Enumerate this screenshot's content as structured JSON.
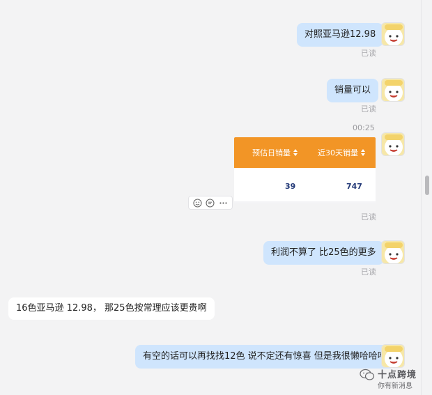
{
  "messages": [
    {
      "id": "m1",
      "text": "对照亚马逊12.98",
      "status": "已读"
    },
    {
      "id": "m2",
      "text": "销量可以",
      "status": "已读"
    },
    {
      "id": "m3",
      "time": "00:25",
      "status": "已读"
    },
    {
      "id": "m4",
      "text": "利润不算了 比25色的更多",
      "status": "已读"
    },
    {
      "id": "m5",
      "text": "16色亚马逊 12.98，  那25色按常理应该更贵啊"
    },
    {
      "id": "m6",
      "text": "有空的话可以再找找12色 说不定还有惊喜 但是我很懒哈哈哈"
    }
  ],
  "card": {
    "headers": [
      "预估日销量",
      "近30天销量"
    ],
    "values": [
      "39",
      "747"
    ],
    "accent": "#f29526"
  },
  "hover_actions": [
    "emoji-icon",
    "quote-icon",
    "more-icon"
  ],
  "watermark": {
    "title": "十点跨境",
    "subtitle": "你有新消息"
  },
  "colors": {
    "outgoing_bubble": "#cfe5fd",
    "incoming_bubble": "#ffffff",
    "background": "#f3f3f4"
  }
}
